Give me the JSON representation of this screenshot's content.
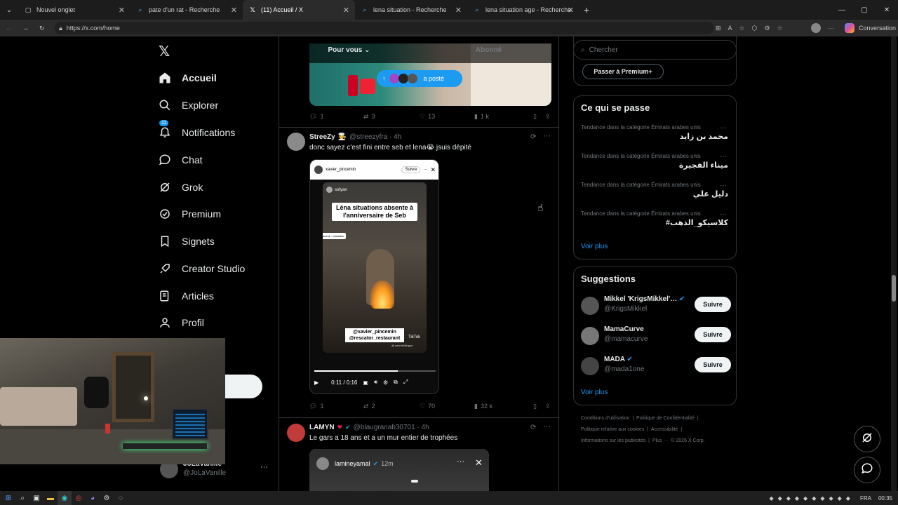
{
  "browser": {
    "tabs": [
      {
        "title": "Nouvel onglet"
      },
      {
        "title": "pate d'un rat - Recherche"
      },
      {
        "title": "(11) Accueil / X"
      },
      {
        "title": "lena situation - Recherche"
      },
      {
        "title": "lena situation age - Recherche"
      }
    ],
    "url": "https://x.com/home",
    "conversation_label": "Conversation"
  },
  "sidebar": {
    "items": [
      {
        "label": "Accueil",
        "icon": "home-icon"
      },
      {
        "label": "Explorer",
        "icon": "search-icon"
      },
      {
        "label": "Notifications",
        "icon": "bell-icon",
        "badge": "11"
      },
      {
        "label": "Chat",
        "icon": "chat-icon"
      },
      {
        "label": "Grok",
        "icon": "grok-icon"
      },
      {
        "label": "Premium",
        "icon": "premium-icon"
      },
      {
        "label": "Signets",
        "icon": "bookmark-icon"
      },
      {
        "label": "Creator Studio",
        "icon": "rocket-icon"
      },
      {
        "label": "Articles",
        "icon": "article-icon"
      },
      {
        "label": "Profil",
        "icon": "person-icon"
      }
    ],
    "account_name": "JoLaVanille",
    "account_handle": "@JoLaVanille"
  },
  "feed": {
    "tab_for_you": "Pour vous",
    "tab_following": "Abonné",
    "new_posts_label": "a posté",
    "post0_actions": {
      "replies": "1",
      "reposts": "3",
      "likes": "13",
      "views": "1 k"
    },
    "post1": {
      "name": "StreeZy",
      "handle": "@streezyfra · 4h",
      "text": "donc sayez c'est fini entre seb et lena😭 jsuis dépité",
      "video": {
        "header_user": "xavier_pincemin",
        "follow": "Suivre",
        "overlay_user": "sofyan",
        "caption": "Léna situations absente à l'anniversaire de Seb",
        "source": "source : cristaline",
        "tags": "@xavier_pincemin @rescator_restaurant",
        "tiktok": "TikTok",
        "tiktok_user": "@ secret2dingue",
        "time": "0:11 / 0:16"
      },
      "actions": {
        "replies": "1",
        "reposts": "2",
        "likes": "70",
        "views": "32 k"
      }
    },
    "post2": {
      "name": "LAMYN",
      "handle": "@blaugranab30701 · 4h",
      "text": "Le gars a 18 ans et a un mur entier de trophées",
      "embed_user": "lamineyamal",
      "embed_time": "12m"
    }
  },
  "right": {
    "search_placeholder": "Chercher",
    "premium_button": "Passer à Premium+",
    "trends_title": "Ce qui se passe",
    "trends": [
      {
        "category": "Tendance dans la catégorie Émirats arabes unis",
        "name": "محمد بن زايد"
      },
      {
        "category": "Tendance dans la catégorie Émirats arabes unis",
        "name": "ميناء الفجيرة"
      },
      {
        "category": "Tendance dans la catégorie Émirats arabes unis",
        "name": "دليل علي"
      },
      {
        "category": "Tendance dans la catégorie Émirats arabes unis",
        "name": "#كلاسيكو_الذهب"
      }
    ],
    "see_more": "Voir plus",
    "suggestions_title": "Suggestions",
    "suggestions": [
      {
        "name": "Mikkel 'KrigsMikkel'…",
        "handle": "@KrigsMikkel",
        "button": "Suivre"
      },
      {
        "name": "MamaCurve",
        "handle": "@mamacurve",
        "button": "Suivre"
      },
      {
        "name": "MADA",
        "handle": "@mada1one",
        "button": "Suivre"
      }
    ],
    "see_more2": "Voir plus",
    "footer": {
      "l1": "Conditions d'utilisation",
      "l2": "Politique de Confidentialité",
      "l3": "Politique relative aux cookies",
      "l4": "Accessibilité",
      "l5": "Informations sur les publicités",
      "l6": "Plus ···",
      "l7": "© 2026 X Corp."
    }
  },
  "taskbar": {
    "lang": "FRA",
    "time": "00:35"
  },
  "colors": {
    "accent": "#1d9bf0",
    "bg": "#000000",
    "border": "#2f3336"
  }
}
